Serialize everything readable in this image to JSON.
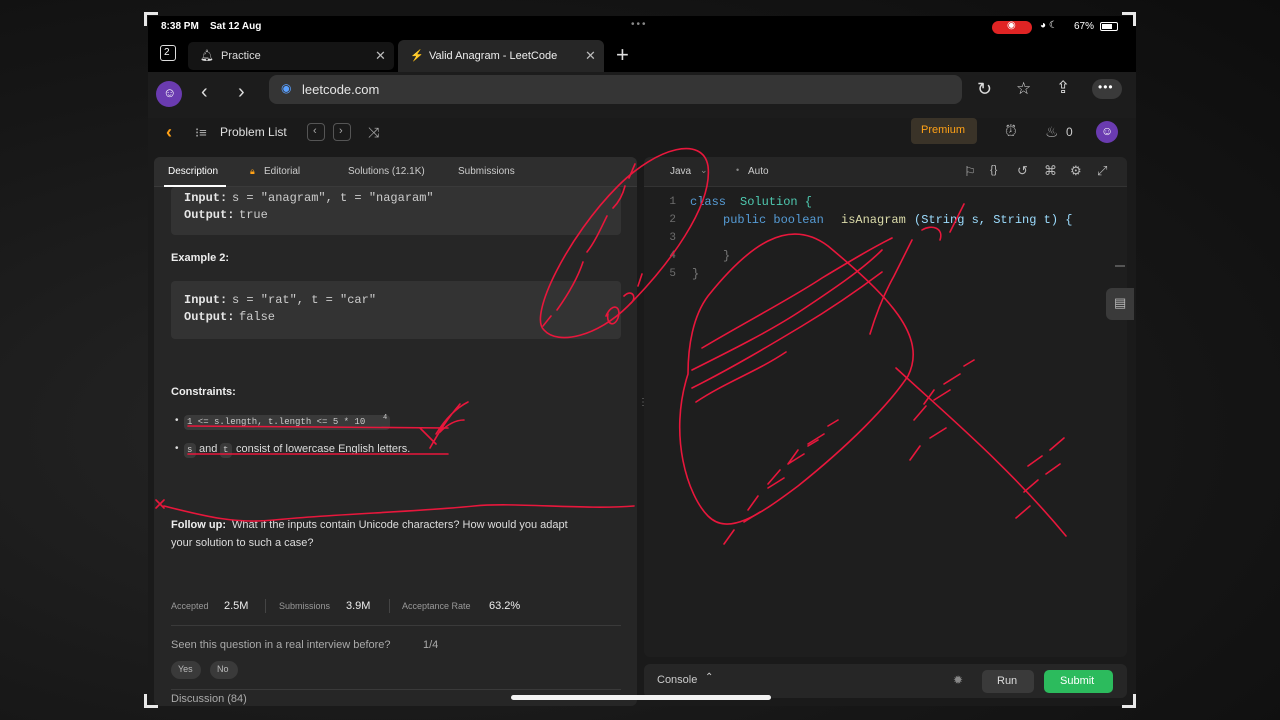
{
  "status": {
    "time": "8:38 PM",
    "date": "Sat 12 Aug",
    "battery": "67%"
  },
  "tabs": {
    "count": "2",
    "tab1": "Practice",
    "tab2": "Valid Anagram - LeetCode"
  },
  "address": {
    "url": "leetcode.com"
  },
  "nav": {
    "problem_list": "Problem List",
    "premium": "Premium",
    "streak": "0"
  },
  "left_tabs": {
    "description": "Description",
    "editorial": "Editorial",
    "solutions": "Solutions (12.1K)",
    "submissions": "Submissions"
  },
  "example1": {
    "input_label": "Input:",
    "input": "s = \"anagram\", t = \"nagaram\"",
    "output_label": "Output:",
    "output": "true"
  },
  "example2": {
    "title": "Example 2:",
    "input_label": "Input:",
    "input": "s = \"rat\", t = \"car\"",
    "output_label": "Output:",
    "output": "false"
  },
  "constraints": {
    "title": "Constraints:",
    "c1": "1 <= s.length, t.length <= 5 * 10",
    "c1_exp": "4",
    "c2_s": "s",
    "c2_and": "and",
    "c2_t": "t",
    "c2_rest": "consist of lowercase English letters."
  },
  "followup": {
    "label": "Follow up:",
    "line1": "What if the inputs contain Unicode characters? How would you adapt",
    "line2": "your solution to such a case?"
  },
  "stats": {
    "accepted_label": "Accepted",
    "accepted": "2.5M",
    "submissions_label": "Submissions",
    "submissions": "3.9M",
    "rate_label": "Acceptance Rate",
    "rate": "63.2%"
  },
  "interview": {
    "question": "Seen this question in a real interview before?",
    "count": "1/4",
    "yes": "Yes",
    "no": "No"
  },
  "discussion": {
    "label": "Discussion (84)"
  },
  "editor": {
    "language": "Java",
    "mode": "Auto",
    "lines": [
      "1",
      "2",
      "3",
      "4",
      "5"
    ],
    "code": {
      "l1_kw": "class",
      "l1_name": "Solution {",
      "l2_kw": "public boolean",
      "l2_fn": "isAnagram",
      "l2_args": "(String s, String t) {",
      "l4": "}",
      "l5": "}"
    }
  },
  "console": {
    "label": "Console",
    "run": "Run",
    "submit": "Submit"
  },
  "colors": {
    "accent_green": "#2cbb5d",
    "premium": "#ffa116",
    "ink": "#e8173c"
  }
}
